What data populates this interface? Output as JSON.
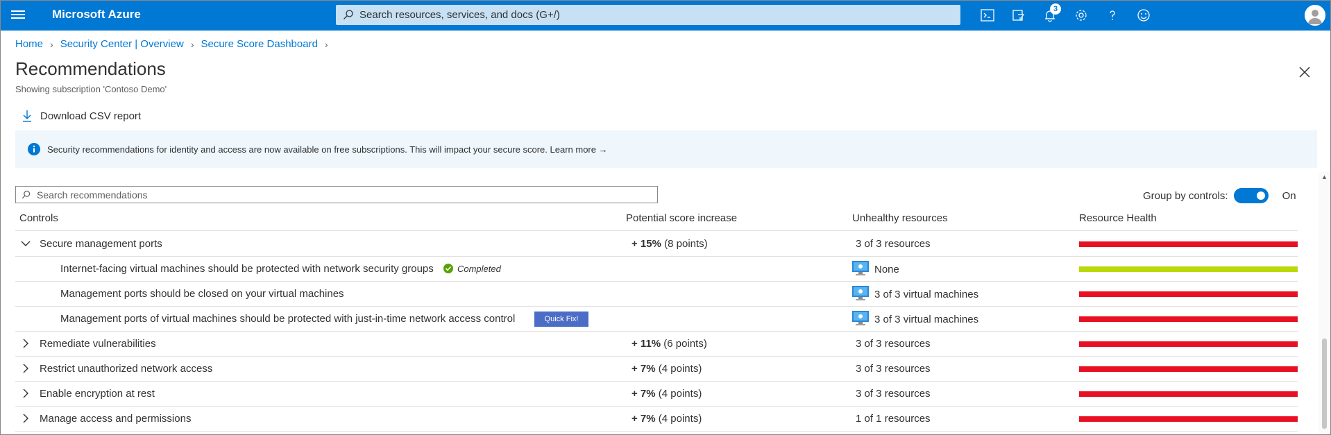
{
  "topbar": {
    "brand": "Microsoft Azure",
    "search_placeholder": "Search resources, services, and docs (G+/)",
    "notification_count": "3",
    "icons": [
      "cloud-shell-icon",
      "directory-filter-icon",
      "notifications-icon",
      "settings-icon",
      "help-icon",
      "feedback-icon"
    ]
  },
  "breadcrumb": [
    "Home",
    "Security Center | Overview",
    "Secure Score Dashboard"
  ],
  "page": {
    "title": "Recommendations",
    "subtitle": "Showing subscription 'Contoso Demo'"
  },
  "toolbar": {
    "download_label": "Download CSV report"
  },
  "banner": {
    "text": "Security recommendations for identity and access are now available on free subscriptions. This will impact your secure score.",
    "link": "Learn more"
  },
  "filters": {
    "search_placeholder": "Search recommendations",
    "group_label": "Group by controls:",
    "group_state": "On",
    "group_enabled": true
  },
  "table": {
    "columns": [
      "Controls",
      "Potential score increase",
      "Unhealthy resources",
      "Resource Health"
    ],
    "rows": [
      {
        "name": "Secure management ports",
        "expanded": true,
        "score": "+ 15%",
        "points": "(8 points)",
        "unhealthy": "3 of 3 resources",
        "health": "red",
        "children": [
          {
            "name": "Internet-facing virtual machines should be protected with network security groups",
            "status": "Completed",
            "unhealthy": "None",
            "health": "green"
          },
          {
            "name": "Management ports should be closed on your virtual machines",
            "unhealthy": "3 of 3 virtual machines",
            "health": "red"
          },
          {
            "name": "Management ports of virtual machines should be protected with just-in-time network access control",
            "action": "Quick Fix!",
            "unhealthy": "3 of 3 virtual machines",
            "health": "red"
          }
        ]
      },
      {
        "name": "Remediate vulnerabilities",
        "expanded": false,
        "score": "+ 11%",
        "points": "(6 points)",
        "unhealthy": "3 of 3 resources",
        "health": "red"
      },
      {
        "name": "Restrict unauthorized network access",
        "expanded": false,
        "score": "+ 7%",
        "points": "(4 points)",
        "unhealthy": "3 of 3 resources",
        "health": "red"
      },
      {
        "name": "Enable encryption at rest",
        "expanded": false,
        "score": "+ 7%",
        "points": "(4 points)",
        "unhealthy": "3 of 3 resources",
        "health": "red"
      },
      {
        "name": "Manage access and permissions",
        "expanded": false,
        "score": "+ 7%",
        "points": "(4 points)",
        "unhealthy": "1 of 1 resources",
        "health": "red"
      }
    ]
  },
  "colors": {
    "accent": "#0078d4",
    "unhealthy": "#e81123",
    "healthy": "#bad80a",
    "quickfix": "#4c6dc6",
    "completed": "#57a300"
  }
}
